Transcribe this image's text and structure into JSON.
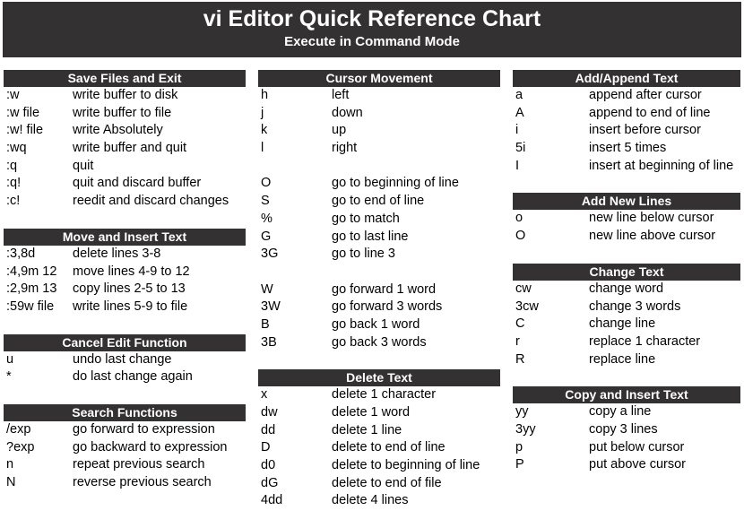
{
  "title": {
    "main": "vi Editor Quick Reference Chart",
    "subtitle": "Execute in Command Mode"
  },
  "colors": {
    "header_bg": "#333132",
    "header_text": "#ffffff",
    "page_bg": "#ffffff",
    "body_text": "#000000"
  },
  "columns": [
    {
      "sections": [
        {
          "heading": "Save Files and Exit",
          "rows": [
            {
              "cmd": ":w",
              "desc": "write buffer to disk"
            },
            {
              "cmd": ":w file",
              "desc": "write buffer to file"
            },
            {
              "cmd": ":w! file",
              "desc": "write Absolutely"
            },
            {
              "cmd": ":wq",
              "desc": "write buffer and quit"
            },
            {
              "cmd": ":q",
              "desc": "quit"
            },
            {
              "cmd": ":q!",
              "desc": "quit and discard buffer"
            },
            {
              "cmd": ":c!",
              "desc": "reedit and discard changes"
            }
          ]
        },
        {
          "heading": "Move and Insert Text",
          "rows": [
            {
              "cmd": ":3,8d",
              "desc": "delete lines 3-8"
            },
            {
              "cmd": ":4,9m 12",
              "desc": "move lines 4-9 to 12"
            },
            {
              "cmd": ":2,9m 13",
              "desc": "copy lines 2-5 to 13"
            },
            {
              "cmd": ":59w file",
              "desc": "write lines 5-9 to file"
            }
          ]
        },
        {
          "heading": "Cancel Edit Function",
          "rows": [
            {
              "cmd": "u",
              "desc": "undo last change"
            },
            {
              "cmd": "*",
              "desc": "do last change again"
            }
          ]
        },
        {
          "heading": "Search Functions",
          "rows": [
            {
              "cmd": "/exp",
              "desc": "go forward to expression"
            },
            {
              "cmd": "?exp",
              "desc": "go backward to expression"
            },
            {
              "cmd": "n",
              "desc": "repeat previous search"
            },
            {
              "cmd": "N",
              "desc": "reverse previous search"
            }
          ]
        }
      ]
    },
    {
      "sections": [
        {
          "heading": "Cursor Movement",
          "rows": [
            {
              "cmd": "h",
              "desc": "left"
            },
            {
              "cmd": "j",
              "desc": "down"
            },
            {
              "cmd": "k",
              "desc": "up"
            },
            {
              "cmd": "l",
              "desc": "right"
            },
            {
              "cmd": "",
              "desc": ""
            },
            {
              "cmd": "O",
              "desc": "go to beginning of line"
            },
            {
              "cmd": "S",
              "desc": "go to end of line"
            },
            {
              "cmd": "%",
              "desc": "go to match"
            },
            {
              "cmd": "G",
              "desc": "go to last line"
            },
            {
              "cmd": "3G",
              "desc": "go to line 3"
            },
            {
              "cmd": "",
              "desc": ""
            },
            {
              "cmd": "W",
              "desc": "go forward 1 word"
            },
            {
              "cmd": "3W",
              "desc": "go forward 3 words"
            },
            {
              "cmd": "B",
              "desc": "go back 1 word"
            },
            {
              "cmd": "3B",
              "desc": "go back 3 words"
            }
          ]
        },
        {
          "heading": "Delete Text",
          "rows": [
            {
              "cmd": "x",
              "desc": "delete 1 character"
            },
            {
              "cmd": "dw",
              "desc": "delete 1 word"
            },
            {
              "cmd": "dd",
              "desc": "delete 1 line"
            },
            {
              "cmd": "D",
              "desc": "delete to end of line"
            },
            {
              "cmd": "d0",
              "desc": "delete to beginning of line"
            },
            {
              "cmd": "dG",
              "desc": "delete to end of file"
            },
            {
              "cmd": "4dd",
              "desc": "delete 4 lines"
            }
          ]
        }
      ]
    },
    {
      "sections": [
        {
          "heading": "Add/Append Text",
          "rows": [
            {
              "cmd": "a",
              "desc": "append after cursor"
            },
            {
              "cmd": "A",
              "desc": "append to end of line"
            },
            {
              "cmd": "i",
              "desc": "insert before cursor"
            },
            {
              "cmd": "5i",
              "desc": "insert 5 times"
            },
            {
              "cmd": "I",
              "desc": "insert at beginning of line"
            }
          ]
        },
        {
          "heading": "Add New Lines",
          "rows": [
            {
              "cmd": "o",
              "desc": "new line below cursor"
            },
            {
              "cmd": "O",
              "desc": "new line above cursor"
            }
          ]
        },
        {
          "heading": "Change Text",
          "rows": [
            {
              "cmd": "cw",
              "desc": "change word"
            },
            {
              "cmd": "3cw",
              "desc": "change 3 words"
            },
            {
              "cmd": "C",
              "desc": "change line"
            },
            {
              "cmd": "r",
              "desc": "replace 1 character"
            },
            {
              "cmd": "R",
              "desc": "replace line"
            }
          ]
        },
        {
          "heading": "Copy and Insert Text",
          "rows": [
            {
              "cmd": "yy",
              "desc": "copy a line"
            },
            {
              "cmd": "3yy",
              "desc": "copy 3 lines"
            },
            {
              "cmd": "p",
              "desc": "put below cursor"
            },
            {
              "cmd": "P",
              "desc": "put above cursor"
            }
          ]
        }
      ]
    }
  ]
}
